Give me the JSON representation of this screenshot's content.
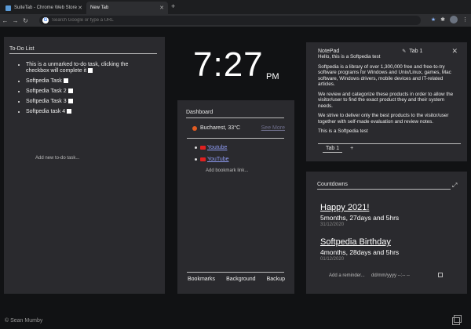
{
  "browser": {
    "tabs": [
      {
        "label": "SuiteTab - Chrome Web Store"
      },
      {
        "label": "New Tab"
      }
    ],
    "omnibox_placeholder": "Search Google or type a URL"
  },
  "todo": {
    "title": "To-Do List",
    "items": [
      "This is a unmarked to-do task, clicking the checkbox will complete it",
      "Softpedia Task",
      "Softpedia Task 2",
      "Softpedia Task 3",
      "Softpedia task 4"
    ],
    "add_label": "Add new to-do task..."
  },
  "clock": {
    "time": "7:27",
    "ampm": "PM"
  },
  "dashboard": {
    "title": "Dashboard",
    "weather": "Bucharest, 33°C",
    "more_label": "See More",
    "bookmarks": [
      "Youtube",
      "YouTube"
    ],
    "add_bookmark": "Add bookmark link...",
    "buttons": [
      "Bookmarks",
      "Background",
      "Backup"
    ]
  },
  "notepad": {
    "title": "NotePad",
    "tab_label": "Tab 1",
    "paragraphs": [
      "Hello, this is a Softpedia test",
      "Softpedia is a library of over 1,300,000 free and free-to-try software programs for Windows and Unix/Linux, games, Mac software, Windows drivers, mobile devices and IT-related articles.",
      "We review and categorize these products in order to allow the visitor/user to find the exact product they and their system needs.",
      "We strive to deliver only the best products to the visitor/user together with self-made evaluation and review notes.",
      "This is a Softpedia test"
    ],
    "tabs": [
      "Tab 1",
      "+"
    ]
  },
  "countdowns": {
    "title": "Countdowns",
    "items": [
      {
        "name": "Happy 2021!",
        "remaining": "5months, 27days and 5hrs",
        "date": "31/12/2020"
      },
      {
        "name": "Softpedia Birthday",
        "remaining": "4months, 28days and 5hrs",
        "date": "01/12/2020"
      }
    ],
    "add_label": "Add a reminder...",
    "date_placeholder": "dd/mm/yyyy --:-- --"
  },
  "credit": "© Sean Mumby"
}
